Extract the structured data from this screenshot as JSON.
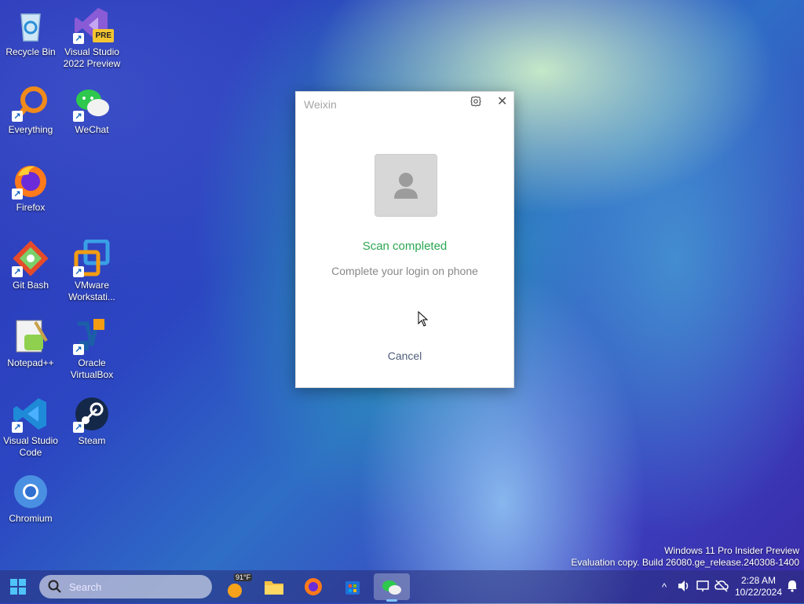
{
  "desktop": {
    "icons": [
      {
        "label": "Recycle Bin",
        "icon": "recycle-bin-icon"
      },
      {
        "label": "Visual Studio 2022 Preview",
        "icon": "visual-studio-preview-icon",
        "badge": "PRE"
      },
      {
        "label": "Everything",
        "icon": "everything-search-icon"
      },
      {
        "label": "WeChat",
        "icon": "wechat-icon"
      },
      {
        "label": "Firefox",
        "icon": "firefox-icon"
      },
      {
        "label": "Git Bash",
        "icon": "git-bash-icon"
      },
      {
        "label": "VMware Workstati...",
        "icon": "vmware-icon"
      },
      {
        "label": "Notepad++",
        "icon": "notepad-plus-plus-icon"
      },
      {
        "label": "Oracle VirtualBox",
        "icon": "virtualbox-icon"
      },
      {
        "label": "Visual Studio Code",
        "icon": "vscode-icon"
      },
      {
        "label": "Steam",
        "icon": "steam-icon"
      },
      {
        "label": "Chromium",
        "icon": "chromium-icon"
      }
    ]
  },
  "dialog": {
    "title": "Weixin",
    "status": "Scan completed",
    "hint": "Complete your login on phone",
    "cancel_label": "Cancel",
    "close_glyph": "✕",
    "status_color": "#2aa751"
  },
  "watermark": {
    "line1": "Windows 11 Pro Insider Preview",
    "line2": "Evaluation copy. Build 26080.ge_release.240308-1400"
  },
  "taskbar": {
    "search_placeholder": "Search",
    "weather_temp": "91°F",
    "time": "2:28 AM",
    "date": "10/22/2024",
    "chevron": "^"
  }
}
